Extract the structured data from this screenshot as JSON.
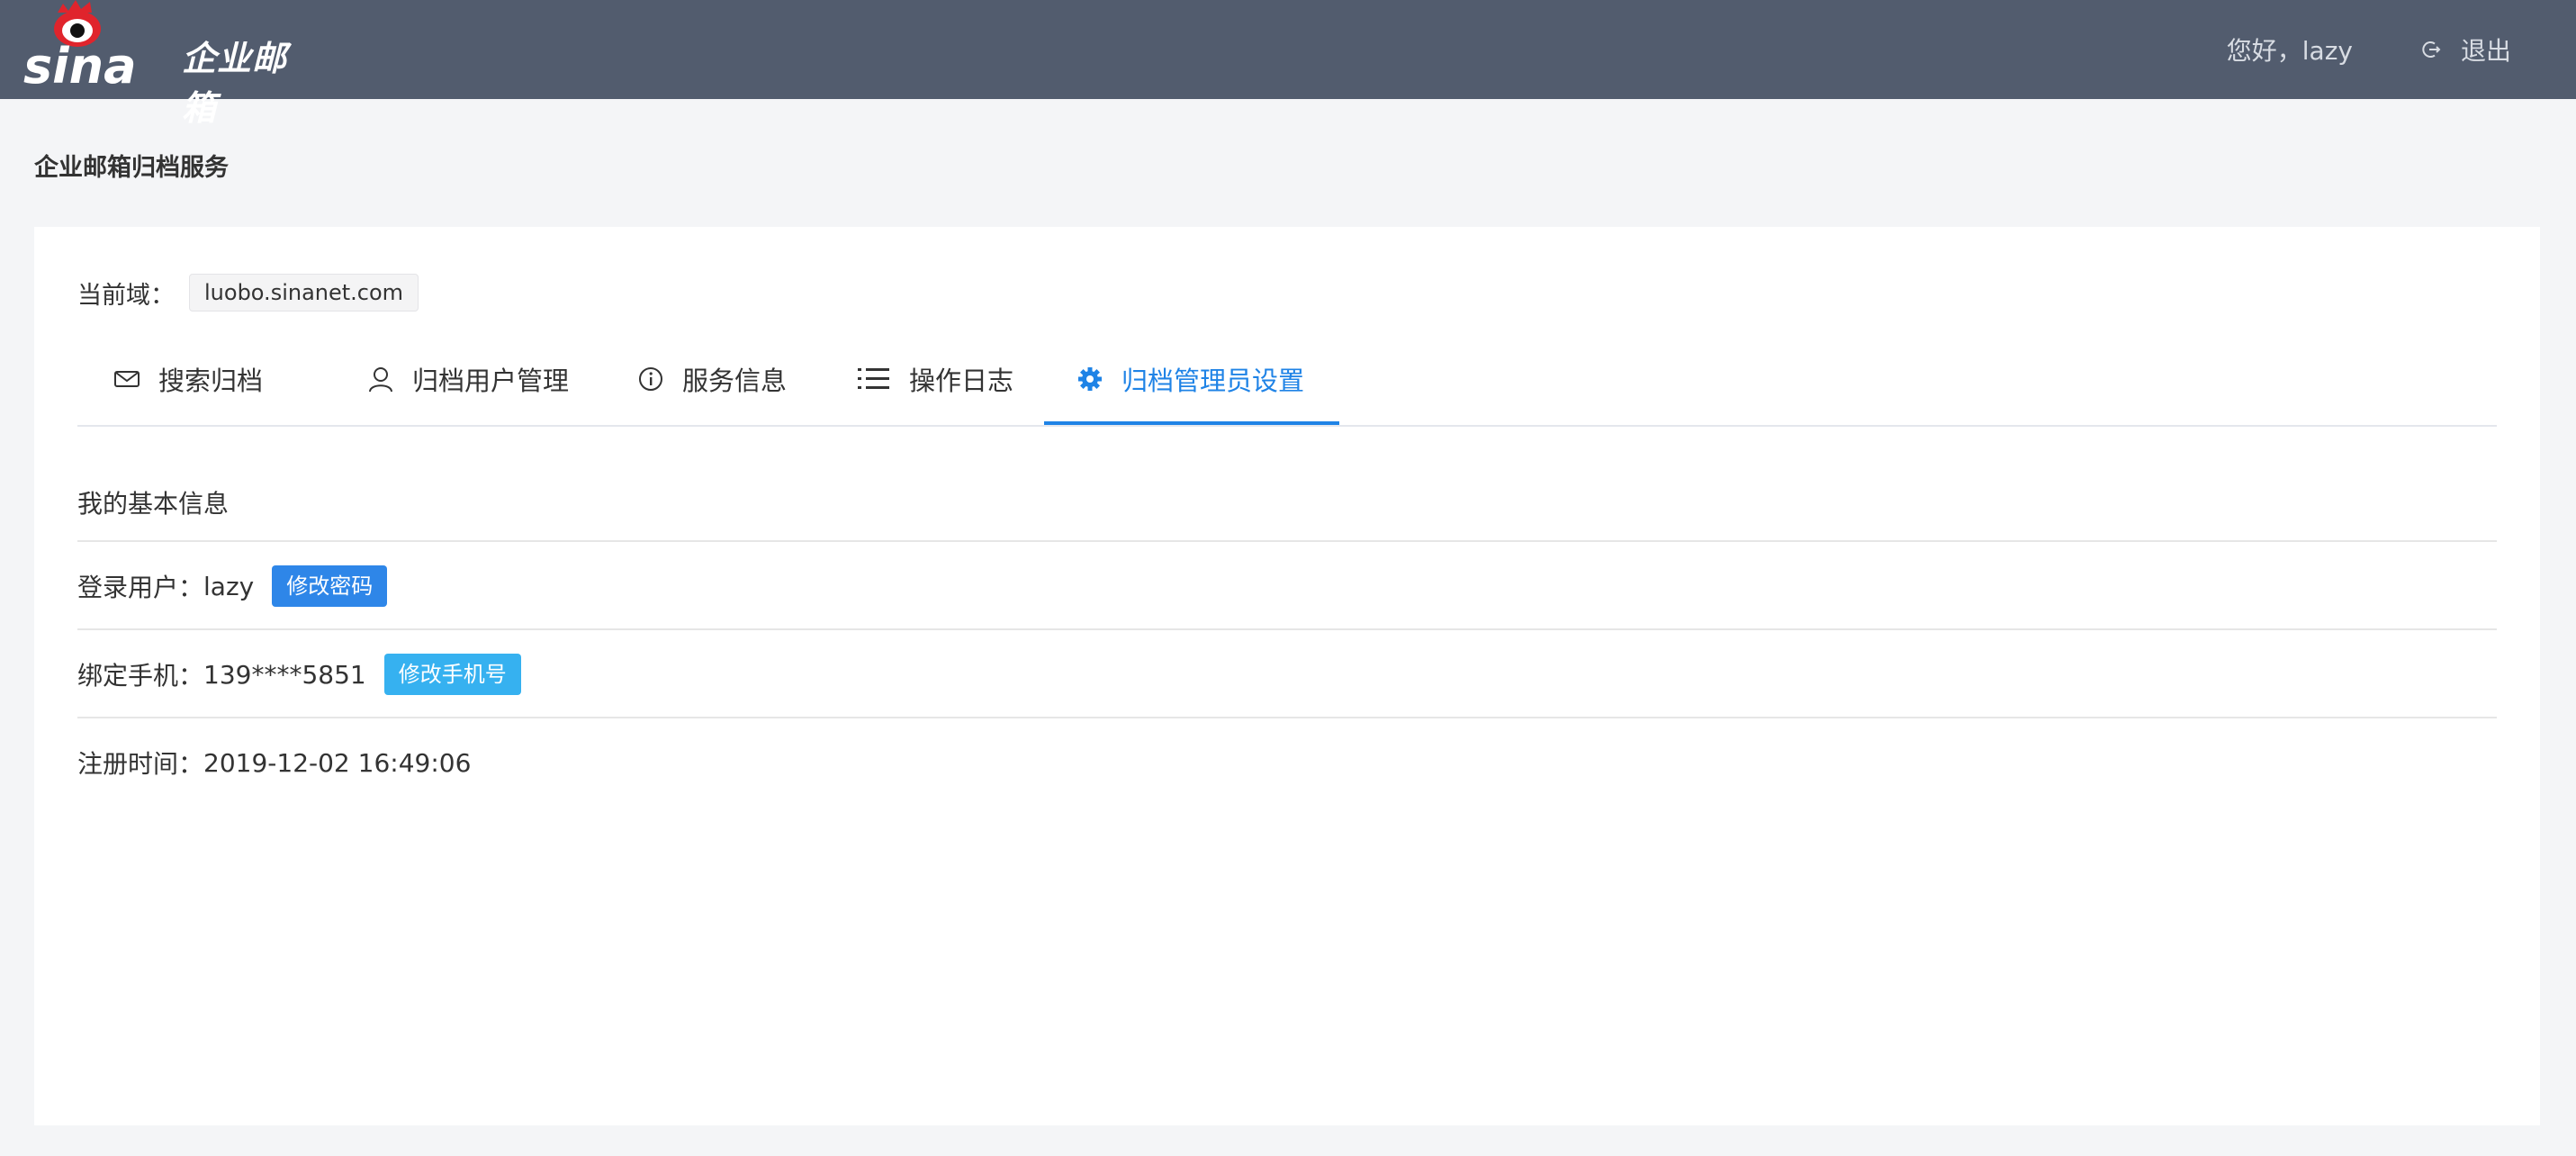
{
  "header": {
    "logo_text": "企业邮箱",
    "greeting": "您好，lazy",
    "logout_label": "退出"
  },
  "page": {
    "title": "企业邮箱归档服务"
  },
  "domain": {
    "label": "当前域：",
    "value": "luobo.sinanet.com"
  },
  "tabs": [
    {
      "label": "搜索归档",
      "icon": "mail-icon"
    },
    {
      "label": "归档用户管理",
      "icon": "user-icon"
    },
    {
      "label": "服务信息",
      "icon": "info-icon"
    },
    {
      "label": "操作日志",
      "icon": "list-icon"
    },
    {
      "label": "归档管理员设置",
      "icon": "gear-icon",
      "active": true
    }
  ],
  "profile": {
    "section_title": "我的基本信息",
    "login_user_label": "登录用户：",
    "login_user_value": "lazy",
    "change_password_label": "修改密码",
    "phone_label": "绑定手机：",
    "phone_value": "139****5851",
    "change_phone_label": "修改手机号",
    "register_time_label": "注册时间：",
    "register_time_value": "2019-12-02 16:49:06"
  },
  "colors": {
    "header_bg": "#525c6e",
    "accent": "#1f83e6",
    "button_blue": "#2e86e8",
    "button_cyan": "#36b1f0"
  }
}
